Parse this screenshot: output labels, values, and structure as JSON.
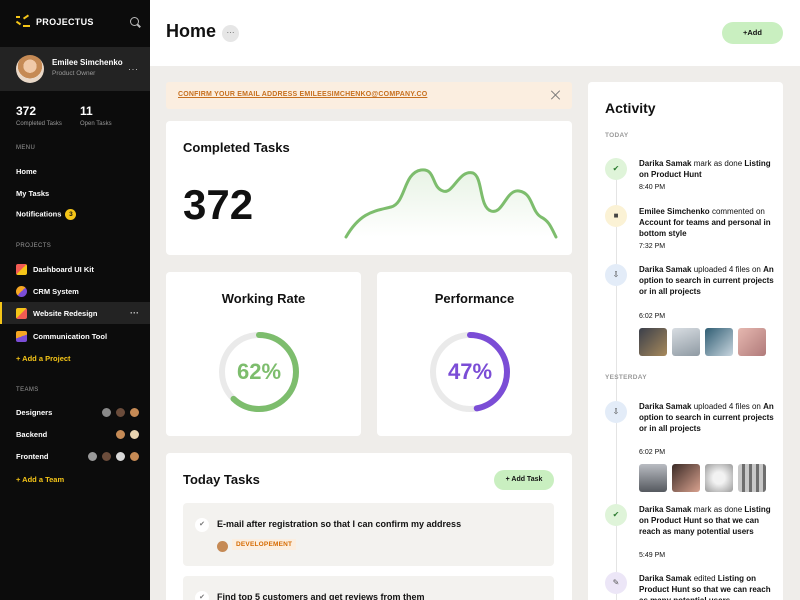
{
  "app": {
    "brand": "PROJECTUS"
  },
  "user": {
    "name": "Emilee Simchenko",
    "role": "Product Owner",
    "more": "···"
  },
  "stats": [
    {
      "value": "372",
      "label": "Completed Tasks"
    },
    {
      "value": "11",
      "label": "Open Tasks"
    }
  ],
  "menu": {
    "label": "MENU",
    "items": [
      {
        "label": "Home"
      },
      {
        "label": "My Tasks"
      },
      {
        "label": "Notifications",
        "badge": "3"
      }
    ]
  },
  "projects": {
    "label": "PROJECTS",
    "items": [
      {
        "label": "Dashboard UI Kit",
        "color": "#f5c518",
        "active": false
      },
      {
        "label": "CRM System",
        "color": "#7b4dd6",
        "active": false
      },
      {
        "label": "Website Redesign",
        "color": "#f25c54",
        "active": true
      },
      {
        "label": "Communication Tool",
        "color": "#f5a623",
        "active": false
      }
    ],
    "add": "+ Add a Project",
    "more": "···"
  },
  "teams": {
    "label": "TEAMS",
    "items": [
      {
        "label": "Designers"
      },
      {
        "label": "Backend"
      },
      {
        "label": "Frontend"
      }
    ],
    "add": "+ Add a Team"
  },
  "header": {
    "title": "Home",
    "more": "···",
    "add_label": "+Add"
  },
  "banner": {
    "text": "CONFIRM YOUR EMAIL ADDRESS EMILEESIMCHENKO@COMPANY.CO"
  },
  "completed": {
    "title": "Completed Tasks",
    "value": "372"
  },
  "working_rate": {
    "title": "Working Rate",
    "value": "62%",
    "fraction": 0.62,
    "color": "#7dbd6d"
  },
  "performance": {
    "title": "Performance",
    "value": "47%",
    "fraction": 0.47,
    "color": "#7b4dd6"
  },
  "today_tasks": {
    "title": "Today Tasks",
    "add_label": "+ Add Task",
    "items": [
      {
        "text": "E-mail after registration so that I can confirm my address",
        "tag": "DEVELOPEMENT"
      },
      {
        "text": "Find top 5 customers and get reviews from them"
      }
    ]
  },
  "activity": {
    "title": "Activity",
    "today_label": "TODAY",
    "yesterday_label": "YESTERDAY",
    "items": [
      {
        "who": "Darika Samak",
        "action": "mark as done",
        "target": "Listing on Product Hunt",
        "time": "8:40 PM",
        "icon": "✔",
        "icon_bg": "#dff4d9"
      },
      {
        "who": "Emilee Simchenko",
        "action": "commented on",
        "target": "Account for teams and personal in bottom style",
        "time": "7:32 PM",
        "icon": "■",
        "icon_bg": "#fbf2d5"
      },
      {
        "who": "Darika Samak",
        "action": "uploaded 4 files on",
        "target": "An option to search in current projects or in all projects",
        "time": "6:02 PM",
        "icon": "⇩",
        "icon_bg": "#e3ecf8"
      },
      {
        "who": "Darika Samak",
        "action": "uploaded 4 files on",
        "target": "An option to search in current projects or in all projects",
        "time": "6:02 PM",
        "icon": "⇩",
        "icon_bg": "#e3ecf8"
      },
      {
        "who": "Darika Samak",
        "action": "mark as done",
        "target": "Listing on Product Hunt so that we can reach as many potential users",
        "time": "5:49 PM",
        "icon": "✔",
        "icon_bg": "#dff4d9"
      },
      {
        "who": "Darika Samak",
        "action": "edited",
        "target": "Listing on Product Hunt so that we can reach as many potential users",
        "icon": "✎",
        "icon_bg": "#ece6f7"
      }
    ]
  }
}
